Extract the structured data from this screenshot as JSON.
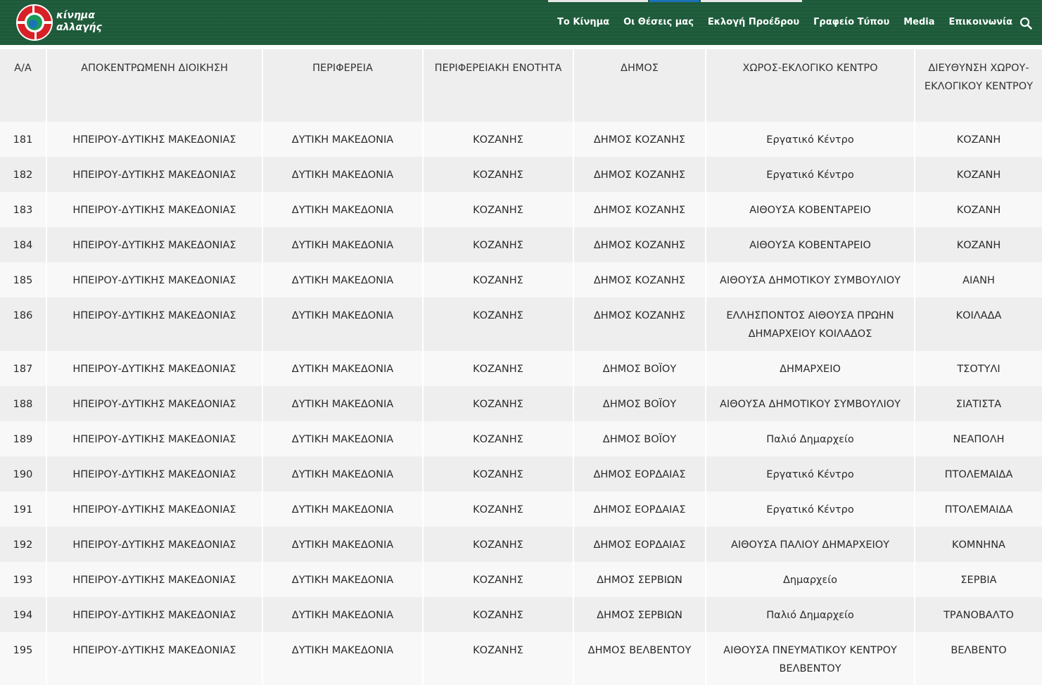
{
  "header": {
    "logo_line1": "κίνημα",
    "logo_line2": "αλλαγής",
    "nav": [
      "Το Κίνημα",
      "Οι Θέσεις μας",
      "Εκλογή Προέδρου",
      "Γραφείο Τύπου",
      "Media",
      "Επικοινωνία"
    ],
    "colors": {
      "bg": "#1d5a3a",
      "tab_left": "#e8e8e8",
      "tab_mid": "#1b72b8",
      "tab_right": "#e8e8e8"
    }
  },
  "table": {
    "headers": [
      "Α/Α",
      "ΑΠΟΚΕΝΤΡΩΜΕΝΗ ΔΙΟΙΚΗΣΗ",
      "ΠΕΡΙΦΕΡΕΙΑ",
      "ΠΕΡΙΦΕΡΕΙΑΚΗ ΕΝΟΤΗΤΑ",
      "ΔΗΜΟΣ",
      "ΧΩΡΟΣ-ΕΚΛΟΓΙΚΟ ΚΕΝΤΡΟ",
      "ΔΙΕΥΘΥΝΣΗ ΧΩΡΟΥ-ΕΚΛΟΓΙΚΟΥ ΚΕΝΤΡΟΥ"
    ],
    "rows": [
      [
        "181",
        "ΗΠΕΙΡΟΥ-ΔΥΤΙΚΗΣ ΜΑΚΕΔΟΝΙΑΣ",
        "ΔΥΤΙΚΗ ΜΑΚΕΔΟΝΙΑ",
        "ΚΟΖΑΝΗΣ",
        "ΔΗΜΟΣ ΚΟΖΑΝΗΣ",
        "Εργατικό Κέντρο",
        "ΚΟΖΑΝΗ"
      ],
      [
        "182",
        "ΗΠΕΙΡΟΥ-ΔΥΤΙΚΗΣ ΜΑΚΕΔΟΝΙΑΣ",
        "ΔΥΤΙΚΗ ΜΑΚΕΔΟΝΙΑ",
        "ΚΟΖΑΝΗΣ",
        "ΔΗΜΟΣ ΚΟΖΑΝΗΣ",
        "Εργατικό Κέντρο",
        "ΚΟΖΑΝΗ"
      ],
      [
        "183",
        "ΗΠΕΙΡΟΥ-ΔΥΤΙΚΗΣ ΜΑΚΕΔΟΝΙΑΣ",
        "ΔΥΤΙΚΗ ΜΑΚΕΔΟΝΙΑ",
        "ΚΟΖΑΝΗΣ",
        "ΔΗΜΟΣ ΚΟΖΑΝΗΣ",
        "ΑΙΘΟΥΣΑ ΚΟΒΕΝΤΑΡΕΙΟ",
        "ΚΟΖΑΝΗ"
      ],
      [
        "184",
        "ΗΠΕΙΡΟΥ-ΔΥΤΙΚΗΣ ΜΑΚΕΔΟΝΙΑΣ",
        "ΔΥΤΙΚΗ ΜΑΚΕΔΟΝΙΑ",
        "ΚΟΖΑΝΗΣ",
        "ΔΗΜΟΣ ΚΟΖΑΝΗΣ",
        "ΑΙΘΟΥΣΑ ΚΟΒΕΝΤΑΡΕΙΟ",
        "ΚΟΖΑΝΗ"
      ],
      [
        "185",
        "ΗΠΕΙΡΟΥ-ΔΥΤΙΚΗΣ ΜΑΚΕΔΟΝΙΑΣ",
        "ΔΥΤΙΚΗ ΜΑΚΕΔΟΝΙΑ",
        "ΚΟΖΑΝΗΣ",
        "ΔΗΜΟΣ ΚΟΖΑΝΗΣ",
        "ΑΙΘΟΥΣΑ ΔΗΜΟΤΙΚΟΥ ΣΥΜΒΟΥΛΙΟΥ",
        "ΑΙΑΝΗ"
      ],
      [
        "186",
        "ΗΠΕΙΡΟΥ-ΔΥΤΙΚΗΣ ΜΑΚΕΔΟΝΙΑΣ",
        "ΔΥΤΙΚΗ ΜΑΚΕΔΟΝΙΑ",
        "ΚΟΖΑΝΗΣ",
        "ΔΗΜΟΣ ΚΟΖΑΝΗΣ",
        "ΕΛΛΗΣΠΟΝΤΟΣ ΑΙΘΟΥΣΑ ΠΡΩΗΝ ΔΗΜΑΡΧΕΙΟΥ ΚΟΙΛΑΔΟΣ",
        "ΚΟΙΛΑΔΑ"
      ],
      [
        "187",
        "ΗΠΕΙΡΟΥ-ΔΥΤΙΚΗΣ ΜΑΚΕΔΟΝΙΑΣ",
        "ΔΥΤΙΚΗ ΜΑΚΕΔΟΝΙΑ",
        "ΚΟΖΑΝΗΣ",
        "ΔΗΜΟΣ ΒΟΪΟΥ",
        "ΔΗΜΑΡΧΕΙΟ",
        "ΤΣΟΤΥΛΙ"
      ],
      [
        "188",
        "ΗΠΕΙΡΟΥ-ΔΥΤΙΚΗΣ ΜΑΚΕΔΟΝΙΑΣ",
        "ΔΥΤΙΚΗ ΜΑΚΕΔΟΝΙΑ",
        "ΚΟΖΑΝΗΣ",
        "ΔΗΜΟΣ ΒΟΪΟΥ",
        "ΑΙΘΟΥΣΑ ΔΗΜΟΤΙΚΟΥ ΣΥΜΒΟΥΛΙΟΥ",
        "ΣΙΑΤΙΣΤΑ"
      ],
      [
        "189",
        "ΗΠΕΙΡΟΥ-ΔΥΤΙΚΗΣ ΜΑΚΕΔΟΝΙΑΣ",
        "ΔΥΤΙΚΗ ΜΑΚΕΔΟΝΙΑ",
        "ΚΟΖΑΝΗΣ",
        "ΔΗΜΟΣ ΒΟΪΟΥ",
        "Παλιό Δημαρχείο",
        "ΝΕΑΠΟΛΗ"
      ],
      [
        "190",
        "ΗΠΕΙΡΟΥ-ΔΥΤΙΚΗΣ ΜΑΚΕΔΟΝΙΑΣ",
        "ΔΥΤΙΚΗ ΜΑΚΕΔΟΝΙΑ",
        "ΚΟΖΑΝΗΣ",
        "ΔΗΜΟΣ ΕΟΡΔΑΙΑΣ",
        "Εργατικό Κέντρο",
        "ΠΤΟΛΕΜΑΙΔΑ"
      ],
      [
        "191",
        "ΗΠΕΙΡΟΥ-ΔΥΤΙΚΗΣ ΜΑΚΕΔΟΝΙΑΣ",
        "ΔΥΤΙΚΗ ΜΑΚΕΔΟΝΙΑ",
        "ΚΟΖΑΝΗΣ",
        "ΔΗΜΟΣ ΕΟΡΔΑΙΑΣ",
        "Εργατικό Κέντρο",
        "ΠΤΟΛΕΜΑΙΔΑ"
      ],
      [
        "192",
        "ΗΠΕΙΡΟΥ-ΔΥΤΙΚΗΣ ΜΑΚΕΔΟΝΙΑΣ",
        "ΔΥΤΙΚΗ ΜΑΚΕΔΟΝΙΑ",
        "ΚΟΖΑΝΗΣ",
        "ΔΗΜΟΣ ΕΟΡΔΑΙΑΣ",
        "ΑΙΘΟΥΣΑ ΠΑΛΙΟΥ ΔΗΜΑΡΧΕΙΟΥ",
        "ΚΟΜΝΗΝΑ"
      ],
      [
        "193",
        "ΗΠΕΙΡΟΥ-ΔΥΤΙΚΗΣ ΜΑΚΕΔΟΝΙΑΣ",
        "ΔΥΤΙΚΗ ΜΑΚΕΔΟΝΙΑ",
        "ΚΟΖΑΝΗΣ",
        "ΔΗΜΟΣ ΣΕΡΒΙΩΝ",
        "Δημαρχείο",
        "ΣΕΡΒΙΑ"
      ],
      [
        "194",
        "ΗΠΕΙΡΟΥ-ΔΥΤΙΚΗΣ ΜΑΚΕΔΟΝΙΑΣ",
        "ΔΥΤΙΚΗ ΜΑΚΕΔΟΝΙΑ",
        "ΚΟΖΑΝΗΣ",
        "ΔΗΜΟΣ ΣΕΡΒΙΩΝ",
        "Παλιό Δημαρχείο",
        "ΤΡΑΝΟΒΑΛΤΟ"
      ],
      [
        "195",
        "ΗΠΕΙΡΟΥ-ΔΥΤΙΚΗΣ ΜΑΚΕΔΟΝΙΑΣ",
        "ΔΥΤΙΚΗ ΜΑΚΕΔΟΝΙΑ",
        "ΚΟΖΑΝΗΣ",
        "ΔΗΜΟΣ ΒΕΛΒΕΝΤΟΥ",
        "ΑΙΘΟΥΣΑ ΠΝΕΥΜΑΤΙΚΟΥ ΚΕΝΤΡΟΥ ΒΕΛΒΕΝΤΟΥ",
        "ΒΕΛΒΕΝΤΟ"
      ]
    ]
  }
}
